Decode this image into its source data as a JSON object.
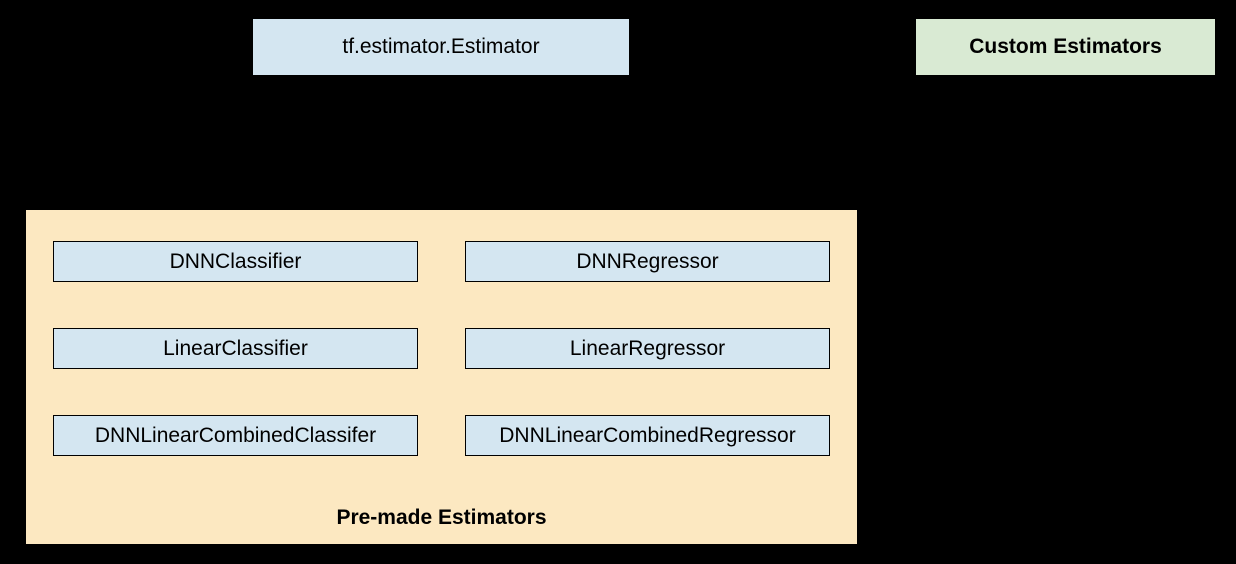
{
  "root": {
    "label": "tf.estimator.Estimator"
  },
  "custom": {
    "label": "Custom Estimators"
  },
  "premade": {
    "title": "Pre-made Estimators",
    "items": [
      {
        "left": "DNNClassifier",
        "right": "DNNRegressor"
      },
      {
        "left": "LinearClassifier",
        "right": "LinearRegressor"
      },
      {
        "left": "DNNLinearCombinedClassifer",
        "right": "DNNLinearCombinedRegressor"
      }
    ]
  }
}
